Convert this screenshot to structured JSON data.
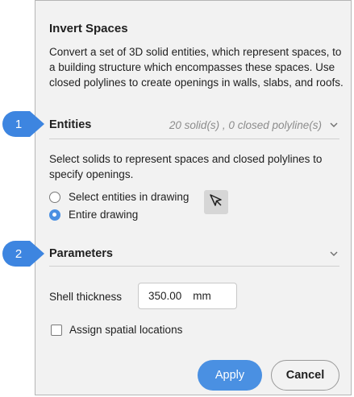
{
  "title": "Invert Spaces",
  "description": "Convert a set of 3D solid entities, which represent spaces, to a building structure which encompasses these spaces. Use closed polylines to create openings in walls, slabs, and roofs.",
  "callouts": [
    "1",
    "2"
  ],
  "entities": {
    "title": "Entities",
    "summary": "20 solid(s) , 0 closed polyline(s)",
    "expand_icon": "chevron-down-icon",
    "instructions": "Select solids to represent spaces and closed polylines to specify openings.",
    "options": [
      {
        "label": "Select entities in drawing",
        "selected": false
      },
      {
        "label": "Entire drawing",
        "selected": true
      }
    ],
    "pick_icon": "cursor-select-icon"
  },
  "parameters": {
    "title": "Parameters",
    "expand_icon": "chevron-down-icon",
    "shell_thickness_label": "Shell thickness",
    "shell_thickness_value": "350.00",
    "shell_thickness_unit": "mm",
    "assign_label": "Assign spatial locations",
    "assign_checked": false
  },
  "buttons": {
    "apply": "Apply",
    "cancel": "Cancel"
  },
  "colors": {
    "accent": "#4a90e2",
    "panel": "#f2f2f2",
    "callout": "#3d85e0"
  }
}
